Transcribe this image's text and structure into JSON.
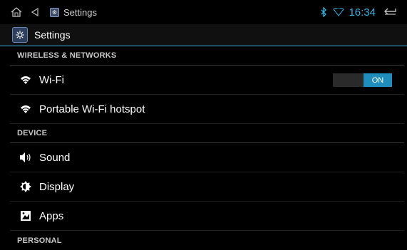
{
  "status_bar": {
    "app_title": "Settings",
    "time": "16:34",
    "colors": {
      "accent": "#33b5e5"
    }
  },
  "action_bar": {
    "title": "Settings"
  },
  "sections": {
    "wireless": {
      "header": "WIRELESS & NETWORKS",
      "wifi": {
        "label": "Wi-Fi",
        "toggle_state": "ON"
      },
      "hotspot": {
        "label": "Portable Wi-Fi hotspot"
      }
    },
    "device": {
      "header": "DEVICE",
      "sound": {
        "label": "Sound"
      },
      "display": {
        "label": "Display"
      },
      "apps": {
        "label": "Apps"
      }
    },
    "personal": {
      "header": "PERSONAL"
    }
  },
  "icons": {
    "home": "home-icon",
    "back": "back-icon",
    "bluetooth": "bluetooth-icon",
    "signal": "signal-icon",
    "return": "return-icon",
    "wifi": "wifi-icon",
    "sound": "speaker-icon",
    "display": "display-icon",
    "apps": "apps-icon"
  }
}
